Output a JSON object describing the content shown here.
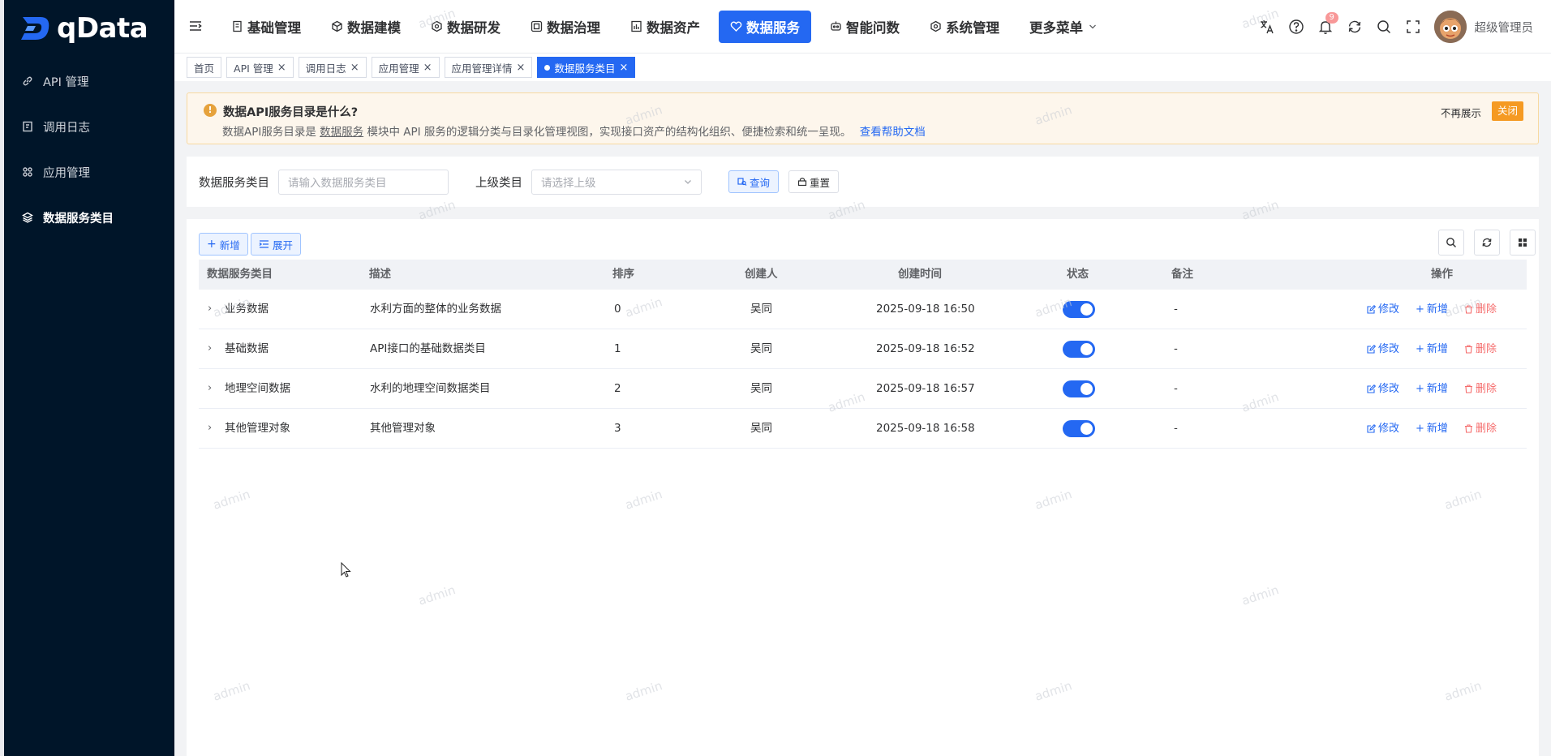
{
  "brand": {
    "name": "qData"
  },
  "sidebar": {
    "items": [
      {
        "label": "API 管理",
        "icon": "link-icon",
        "active": false
      },
      {
        "label": "调用日志",
        "icon": "log-icon",
        "active": false
      },
      {
        "label": "应用管理",
        "icon": "app-icon",
        "active": false
      },
      {
        "label": "数据服务类目",
        "icon": "layers-icon",
        "active": true
      }
    ]
  },
  "header": {
    "nav": [
      {
        "label": "基础管理",
        "icon": "doc-icon",
        "active": false
      },
      {
        "label": "数据建模",
        "icon": "cube-icon",
        "active": false
      },
      {
        "label": "数据研发",
        "icon": "hexagon-icon",
        "active": false
      },
      {
        "label": "数据治理",
        "icon": "shield-grid-icon",
        "active": false
      },
      {
        "label": "数据资产",
        "icon": "asset-icon",
        "active": false
      },
      {
        "label": "数据服务",
        "icon": "heart-icon",
        "active": true
      },
      {
        "label": "智能问数",
        "icon": "robot-icon",
        "active": false
      },
      {
        "label": "系统管理",
        "icon": "settings-icon",
        "active": false
      },
      {
        "label": "更多菜单",
        "icon": "chevron-down-icon",
        "active": false
      }
    ],
    "notification_count": "9",
    "user_name": "超级管理员"
  },
  "tags": [
    {
      "label": "首页",
      "closable": false,
      "active": false
    },
    {
      "label": "API 管理",
      "closable": true,
      "active": false
    },
    {
      "label": "调用日志",
      "closable": true,
      "active": false
    },
    {
      "label": "应用管理",
      "closable": true,
      "active": false
    },
    {
      "label": "应用管理详情",
      "closable": true,
      "active": false
    },
    {
      "label": "数据服务类目",
      "closable": true,
      "active": true
    }
  ],
  "notice": {
    "title": "数据API服务目录是什么?",
    "text_before": "数据API服务目录是",
    "text_link_inline": "数据服务",
    "text_after": "模块中 API 服务的逻辑分类与目录化管理视图，实现接口资产的结构化组织、便捷检索和统一呈现。",
    "help_link": "查看帮助文档",
    "dismiss_label": "不再展示",
    "close_label": "关闭"
  },
  "search": {
    "category_label": "数据服务类目",
    "category_placeholder": "请输入数据服务类目",
    "parent_label": "上级类目",
    "parent_placeholder": "请选择上级",
    "query_label": "查询",
    "reset_label": "重置"
  },
  "toolbar": {
    "add_label": "新增",
    "expand_label": "展开"
  },
  "table": {
    "columns": [
      "数据服务类目",
      "描述",
      "排序",
      "创建人",
      "创建时间",
      "状态",
      "备注",
      "操作"
    ],
    "rows": [
      {
        "name": "业务数据",
        "desc": "水利方面的整体的业务数据",
        "order": "0",
        "creator": "吴同",
        "time": "2025-09-18 16:50",
        "enabled": true,
        "remark": "-"
      },
      {
        "name": "基础数据",
        "desc": "API接口的基础数据类目",
        "order": "1",
        "creator": "吴同",
        "time": "2025-09-18 16:52",
        "enabled": true,
        "remark": "-"
      },
      {
        "name": "地理空间数据",
        "desc": "水利的地理空间数据类目",
        "order": "2",
        "creator": "吴同",
        "time": "2025-09-18 16:57",
        "enabled": true,
        "remark": "-"
      },
      {
        "name": "其他管理对象",
        "desc": "其他管理对象",
        "order": "3",
        "creator": "吴同",
        "time": "2025-09-18 16:58",
        "enabled": true,
        "remark": "-"
      }
    ],
    "actions": {
      "edit": "修改",
      "add": "新增",
      "delete": "删除"
    }
  },
  "watermark": "admin",
  "colors": {
    "primary": "#2468f2",
    "sidebar_bg": "#001529",
    "danger": "#f56c6c",
    "notice_bg": "#fdf6ec",
    "notice_close": "#f59a23"
  }
}
